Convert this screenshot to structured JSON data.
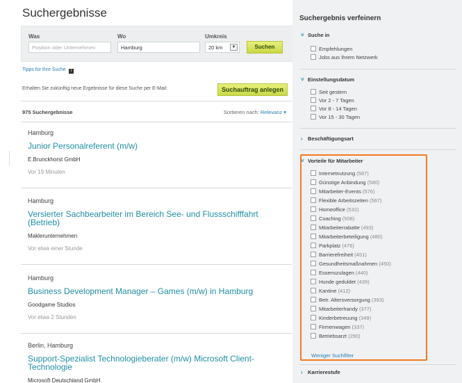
{
  "page_title": "Suchergebnisse",
  "search": {
    "was_label": "Was",
    "was_placeholder": "Position oder Unternehmen",
    "wo_label": "Wo",
    "wo_value": "Hamburg",
    "umkreis_label": "Umkreis",
    "umkreis_value": "20 km",
    "button": "Suchen"
  },
  "tips": "Tipps für Ihre Suche",
  "alert": {
    "text": "Erhalten Sie zukünftig neue Ergebnisse für diese Suche per E-Mail:",
    "button": "Suchauftrag anlegen"
  },
  "results": {
    "count": "975 Suchergebnisse",
    "sort_label": "Sortieren nach:",
    "sort_value": "Relevanz"
  },
  "jobs": [
    {
      "location": "Hamburg",
      "title": "Junior Personalreferent (m/w)",
      "company": "E.Brunckhorst GmbH",
      "time": "Vor 19 Minuten"
    },
    {
      "location": "Hamburg",
      "title": "Versierter Sachbearbeiter im Bereich See- und Flussschifffahrt (Betrieb)",
      "company": "Maklerunternehmen",
      "time": "Vor etwa einer Stunde"
    },
    {
      "location": "Hamburg",
      "title": "Business Development Manager – Games (m/w) in Hamburg",
      "company": "Goodgame Studios",
      "time": "Vor etwa 2 Stunden"
    },
    {
      "location": "Berlin, Hamburg",
      "title": "Support-Spezialist Technologieberater (m/w) Microsoft Client-Technologie",
      "company": "Microsoft Deutschland GmbH",
      "time": ""
    }
  ],
  "sidebar": {
    "title": "Suchergebnis verfeinern",
    "suche_in": {
      "label": "Suche in",
      "items": [
        "Empfehlungen",
        "Jobs aus Ihrem Netzwerk"
      ]
    },
    "datum": {
      "label": "Einstellungsdatum",
      "items": [
        "Seit gestern",
        "Vor 2 - 7 Tagen",
        "Vor 8 - 14 Tagen",
        "Vor 15 - 30 Tagen"
      ]
    },
    "beschaeftigungsart": "Beschäftigungsart",
    "vorteile": {
      "label": "Vorteile für Mitarbeiter",
      "items": [
        {
          "name": "Internetnutzung",
          "count": "(587)"
        },
        {
          "name": "Günstige Anbindung",
          "count": "(580)"
        },
        {
          "name": "Mitarbeiter-Events",
          "count": "(576)"
        },
        {
          "name": "Flexible Arbeitszeiten",
          "count": "(567)"
        },
        {
          "name": "Homeoffice",
          "count": "(532)"
        },
        {
          "name": "Coaching",
          "count": "(508)"
        },
        {
          "name": "Mitarbeiterrabatte",
          "count": "(493)"
        },
        {
          "name": "Mitarbeiterbeteiligung",
          "count": "(480)"
        },
        {
          "name": "Parkplatz",
          "count": "(476)"
        },
        {
          "name": "Barrierefreiheit",
          "count": "(451)"
        },
        {
          "name": "Gesundheitsmaßnahmen",
          "count": "(450)"
        },
        {
          "name": "Essenszulagen",
          "count": "(440)"
        },
        {
          "name": "Hunde geduldet",
          "count": "(439)"
        },
        {
          "name": "Kantine",
          "count": "(412)"
        },
        {
          "name": "Betr. Altersversorgung",
          "count": "(393)"
        },
        {
          "name": "Mitarbeiterhandy",
          "count": "(377)"
        },
        {
          "name": "Kinderbetreuung",
          "count": "(349)"
        },
        {
          "name": "Firmenwagen",
          "count": "(337)"
        },
        {
          "name": "Betriebsarzt",
          "count": "(290)"
        }
      ],
      "fewer": "Weniger Suchfilter"
    },
    "karrierestufe": "Karrierestufe"
  },
  "colors": {
    "accent": "#1f8fa5",
    "highlight": "#f07a24",
    "button": "#c9d846"
  }
}
